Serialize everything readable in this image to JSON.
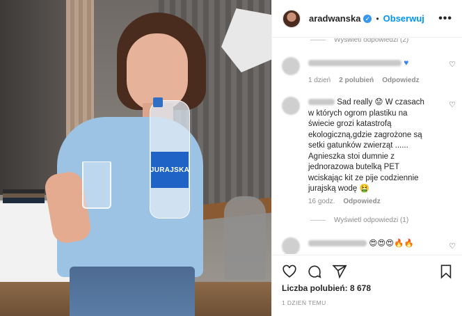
{
  "photo": {
    "bottle_label": "JURAJSKA"
  },
  "header": {
    "username": "aradwanska",
    "separator": "•",
    "follow_label": "Obserwuj",
    "more_label": "•••"
  },
  "comments": {
    "top_replies_label": "Wyświetl odpowiedzi (2)",
    "first": {
      "meta_time": "1 dzień",
      "meta_likes": "2 polubień",
      "meta_reply": "Odpowiedz"
    },
    "second": {
      "text": "Sad really 😟 W czasach w których ogrom plastiku na świecie grozi katastrofą ekologiczną,gdzie zagrożone są setki gatunków zwierząt ...... Agnieszka stoi dumnie z jednorazowa butelką PET wciskając kit ze pije codziennie jurajską wodę 🤮",
      "meta_time": "16 godz.",
      "meta_reply": "Odpowiedz",
      "replies_label": "Wyświetl odpowiedzi (1)"
    },
    "third": {
      "emojis": "😍😍😍🔥🔥"
    }
  },
  "actions": {
    "likes_label": "Liczba polubień: 8 678",
    "time_label": "1 DZIEŃ TEMU"
  },
  "colors": {
    "accent": "#0095f6",
    "verified": "#3897f0",
    "muted": "#8e8e8e"
  }
}
